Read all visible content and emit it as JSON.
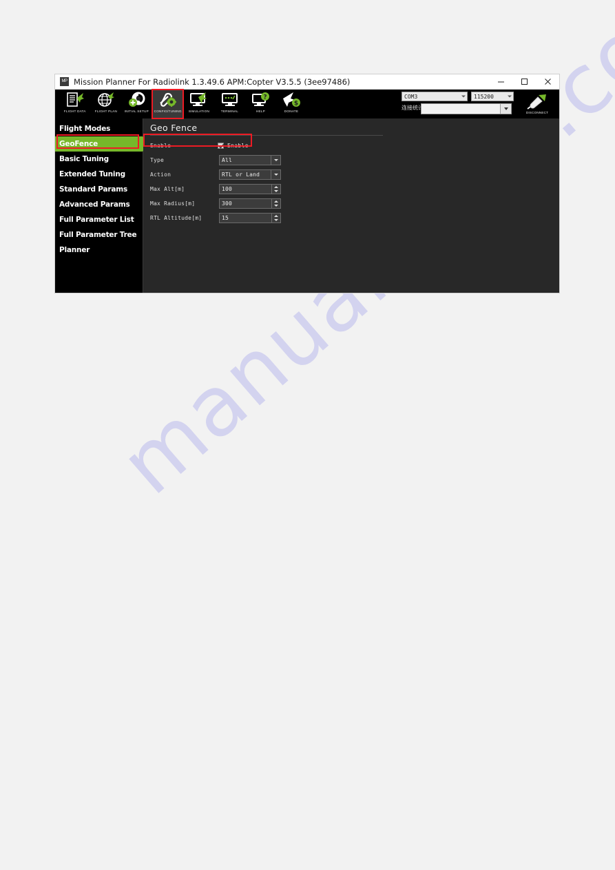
{
  "window": {
    "title": "Mission Planner For Radiolink 1.3.49.6 APM:Copter V3.5.5 (3ee97486)",
    "app_icon": "MP",
    "minimize": "–",
    "maximize": "□",
    "close": "✕"
  },
  "toolbar": {
    "items": [
      {
        "label": "FLIGHT DATA",
        "icon": "flight-data-icon",
        "selected": false
      },
      {
        "label": "FLIGHT PLAN",
        "icon": "flight-plan-icon",
        "selected": false
      },
      {
        "label": "INITIAL SETUP",
        "icon": "initial-setup-icon",
        "selected": false
      },
      {
        "label": "CONFIG/TUNING",
        "icon": "config-tuning-icon",
        "selected": true
      },
      {
        "label": "SIMULATION",
        "icon": "simulation-icon",
        "selected": false
      },
      {
        "label": "TERMINAL",
        "icon": "terminal-icon",
        "selected": false
      },
      {
        "label": "HELP",
        "icon": "help-icon",
        "selected": false
      },
      {
        "label": "DONATE",
        "icon": "donate-icon",
        "selected": false
      }
    ]
  },
  "connection": {
    "port": "COM3",
    "baud": "115200",
    "link_label": "连接统计",
    "link_value": "",
    "disconnect_label": "DISCONNECT",
    "disconnect_icon": "plug-icon"
  },
  "sidebar": {
    "items": [
      {
        "label": "Flight Modes",
        "active": false
      },
      {
        "label": "GeoFence",
        "active": true
      },
      {
        "label": "Basic Tuning",
        "active": false
      },
      {
        "label": "Extended Tuning",
        "active": false
      },
      {
        "label": "Standard Params",
        "active": false
      },
      {
        "label": "Advanced Params",
        "active": false
      },
      {
        "label": "Full Parameter List",
        "active": false
      },
      {
        "label": "Full Parameter Tree",
        "active": false
      },
      {
        "label": "Planner",
        "active": false
      }
    ]
  },
  "panel": {
    "title": "Geo Fence",
    "fields": {
      "enable_label": "Enable",
      "enable_checkbox_label": "Enable",
      "enable_checked": true,
      "type_label": "Type",
      "type_value": "All",
      "action_label": "Action",
      "action_value": "RTL or Land",
      "max_alt_label": "Max Alt[m]",
      "max_alt_value": "100",
      "max_radius_label": "Max Radius[m]",
      "max_radius_value": "300",
      "rtl_altitude_label": "RTL Altitude[m]",
      "rtl_altitude_value": "15"
    }
  },
  "highlights": {
    "accent_red": "#ee1b24",
    "accent_green": "#76b82a"
  },
  "watermark": {
    "text": "manualshive.com"
  }
}
